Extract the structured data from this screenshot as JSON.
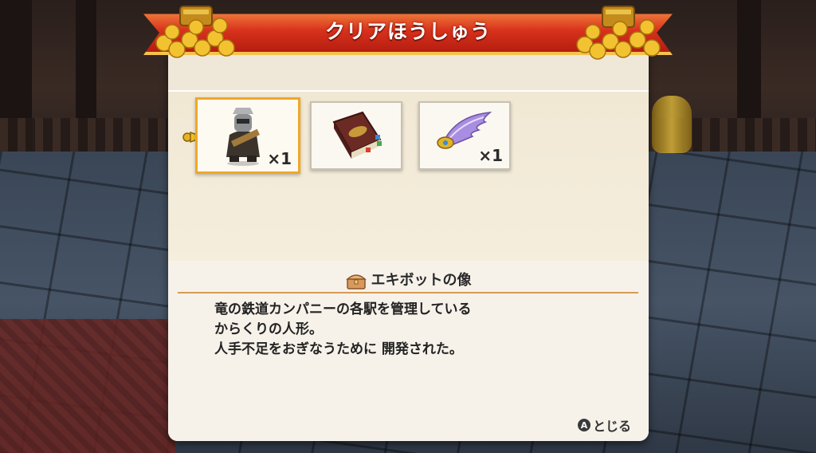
{
  "banner": {
    "title": "クリアほうしゅう"
  },
  "rewards": [
    {
      "name": "エキボットの像",
      "quantity": "×1",
      "icon": "robot-figure-icon",
      "selected": true
    },
    {
      "name": "",
      "quantity": "",
      "icon": "book-icon",
      "selected": false
    },
    {
      "name": "",
      "quantity": "×1",
      "icon": "wing-icon",
      "selected": false
    }
  ],
  "detail": {
    "item_name": "エキボットの像",
    "description_lines": [
      "竜の鉄道カンパニーの各駅を管理している",
      "からくりの人形。",
      "人手不足をおぎなうために 開発された。"
    ]
  },
  "controls": {
    "button": "A",
    "close_label": "とじる"
  },
  "colors": {
    "banner_red": "#d8321c",
    "gold": "#f6c24c",
    "selection": "#f0a726",
    "divider": "#d69a55"
  }
}
